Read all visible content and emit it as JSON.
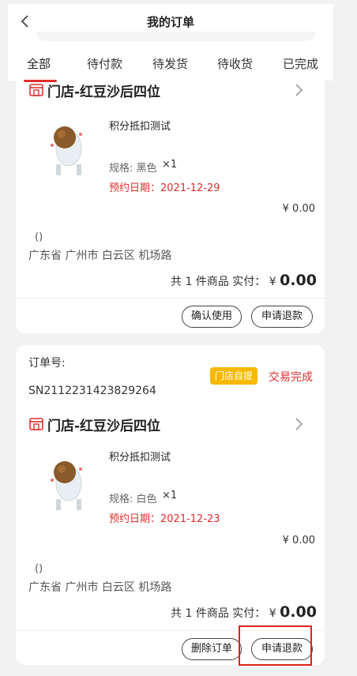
{
  "header": {
    "title": "我的订单",
    "tabs": [
      {
        "label": "全部",
        "active": true
      },
      {
        "label": "待付款",
        "active": false
      },
      {
        "label": "待发货",
        "active": false
      },
      {
        "label": "待收货",
        "active": false
      },
      {
        "label": "已完成",
        "active": false
      }
    ]
  },
  "orders": [
    {
      "store_name": "门店-红豆沙后四位",
      "product_name": "积分抵扣测试",
      "spec": "规格: 黑色",
      "qty": "×1",
      "reserve": "预约日期：2021-12-29",
      "price": "¥ 0.00",
      "addr_name": "()",
      "address": "广东省 广州市 白云区 机场路",
      "total_prefix": "共 1 件商品  实付：",
      "total_currency": "¥",
      "total_amount": "0.00",
      "buttons": [
        "确认使用",
        "申请退款"
      ]
    },
    {
      "order_label": "订单号:",
      "order_no": "SN2112231423829264",
      "badge": "门店自提",
      "status": "交易完成",
      "store_name": "门店-红豆沙后四位",
      "product_name": "积分抵扣测试",
      "spec": "规格: 白色",
      "qty": "×1",
      "reserve": "预约日期：2021-12-23",
      "price": "¥ 0.00",
      "addr_name": "()",
      "address": "广东省 广州市 白云区 机场路",
      "total_prefix": "共 1 件商品  实付：",
      "total_currency": "¥",
      "total_amount": "0.00",
      "buttons": [
        "删除订单",
        "申请退款"
      ]
    }
  ],
  "colors": {
    "accent": "#e02e2e",
    "badge": "#f7b800",
    "background": "#f2f2f2"
  }
}
